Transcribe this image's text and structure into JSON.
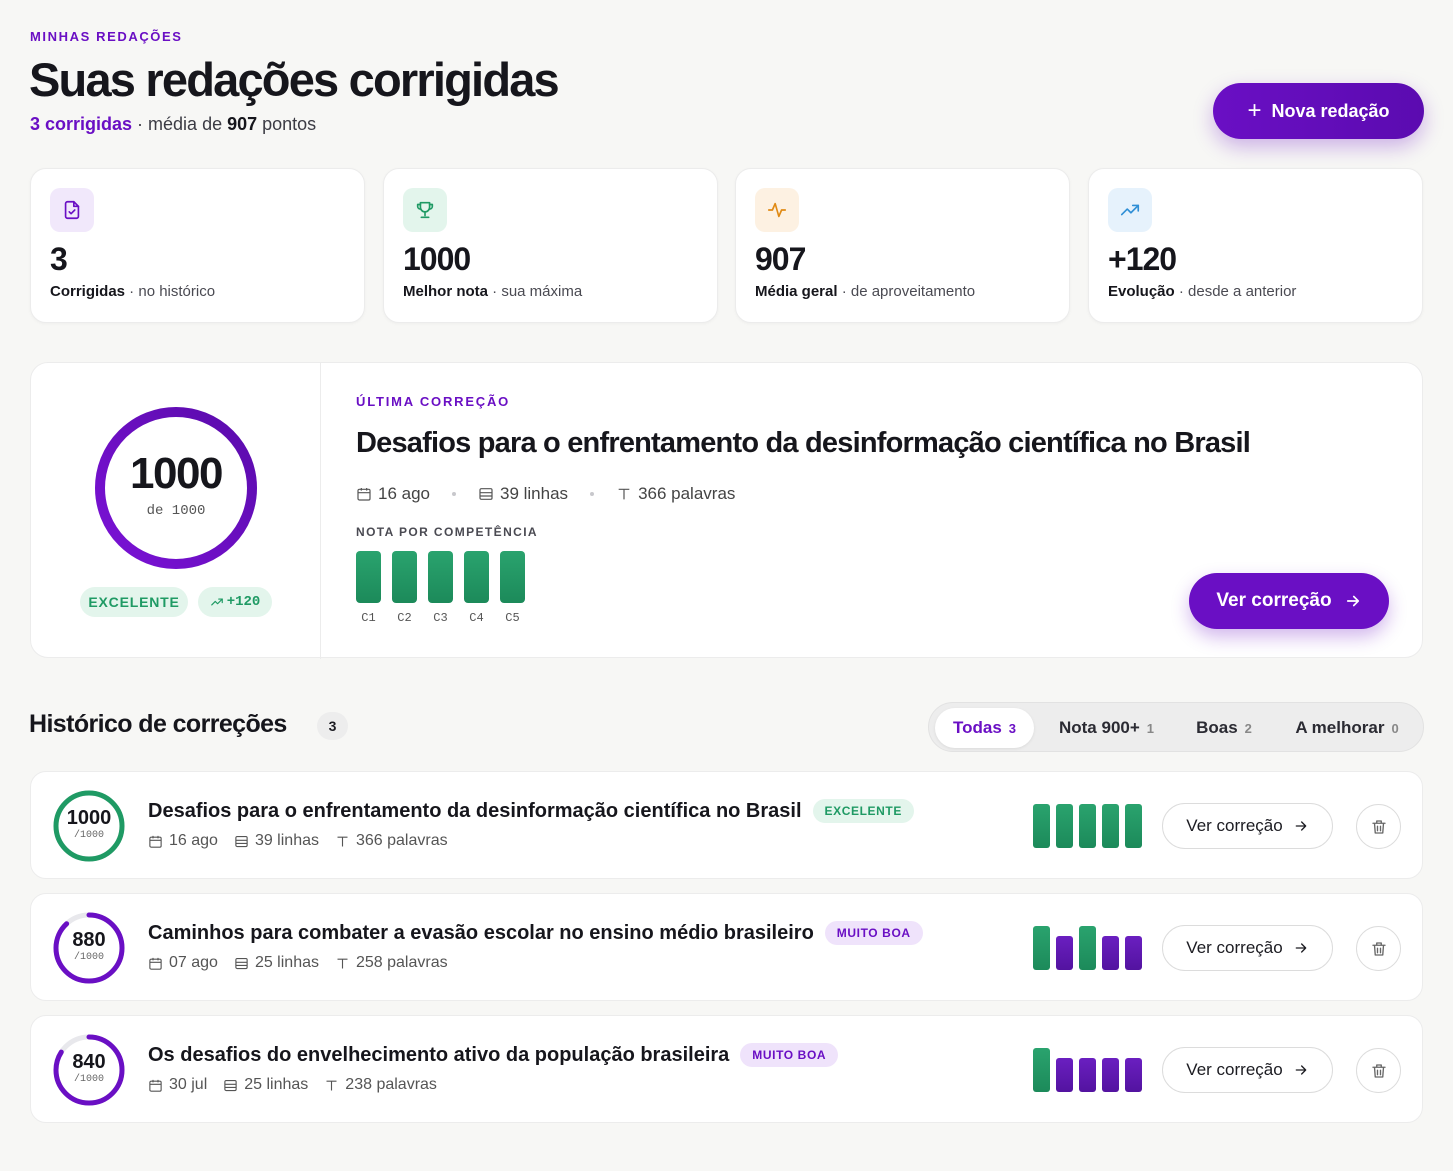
{
  "header": {
    "eyebrow": "MINHAS REDAÇÕES",
    "title": "Suas redações corrigidas",
    "subtitle_count": "3 corrigidas",
    "subtitle_mid": " · média de ",
    "subtitle_avg": "907",
    "subtitle_end": " pontos",
    "new_button": "Nova redação"
  },
  "stats": [
    {
      "icon": "document-check-icon",
      "value": "3",
      "label_bold": "Corrigidas",
      "label_rest": " · no histórico",
      "color": "#6a0fc4"
    },
    {
      "icon": "trophy-icon",
      "value": "1000",
      "label_bold": "Melhor nota",
      "label_rest": " · sua máxima",
      "color": "#1f9a64"
    },
    {
      "icon": "activity-icon",
      "value": "907",
      "label_bold": "Média geral",
      "label_rest": " · de aproveitamento",
      "color": "#e08a14"
    },
    {
      "icon": "trending-up-icon",
      "value": "+120",
      "label_bold": "Evolução",
      "label_rest": " · desde a anterior",
      "color": "#2f8fd6"
    }
  ],
  "latest": {
    "score": "1000",
    "score_of": "de 1000",
    "score_fraction": 1.0,
    "level": "EXCELENTE",
    "delta": "+120",
    "eyebrow": "ÚLTIMA CORREÇÃO",
    "title": "Desafios para o enfrentamento da desinformação científica no Brasil",
    "date": "16 ago",
    "lines": "39 linhas",
    "words": "366 palavras",
    "competence_label": "NOTA POR COMPETÊNCIA",
    "competencies": [
      "C1",
      "C2",
      "C3",
      "C4",
      "C5"
    ],
    "view_button": "Ver correção"
  },
  "history": {
    "title": "Histórico de correções",
    "count": "3",
    "filters": [
      {
        "label": "Todas",
        "count": "3",
        "active": true
      },
      {
        "label": "Nota 900+",
        "count": "1",
        "active": false
      },
      {
        "label": "Boas",
        "count": "2",
        "active": false
      },
      {
        "label": "A melhorar",
        "count": "0",
        "active": false
      }
    ],
    "rows": [
      {
        "score": "1000",
        "of": "/1000",
        "fraction": 1.0,
        "ring_color": "#1f9a64",
        "title": "Desafios para o enfrentamento da desinformação científica no Brasil",
        "badge": "EXCELENTE",
        "badge_kind": "green",
        "date": "16 ago",
        "lines": "39 linhas",
        "words": "366 palavras",
        "bars": [
          "green",
          "green",
          "green",
          "green",
          "green"
        ],
        "view": "Ver correção"
      },
      {
        "score": "880",
        "of": "/1000",
        "fraction": 0.88,
        "ring_color": "#6a0fc4",
        "title": "Caminhos para combater a evasão escolar no ensino médio brasileiro",
        "badge": "MUITO BOA",
        "badge_kind": "purple",
        "date": "07 ago",
        "lines": "25 linhas",
        "words": "258 palavras",
        "bars": [
          "green",
          "purple",
          "green",
          "purple",
          "purple"
        ],
        "view": "Ver correção"
      },
      {
        "score": "840",
        "of": "/1000",
        "fraction": 0.84,
        "ring_color": "#6a0fc4",
        "title": "Os desafios do envelhecimento ativo da população brasileira",
        "badge": "MUITO BOA",
        "badge_kind": "purple",
        "date": "30 jul",
        "lines": "25 linhas",
        "words": "238 palavras",
        "bars": [
          "green",
          "purple",
          "purple",
          "purple",
          "purple"
        ],
        "view": "Ver correção"
      }
    ]
  }
}
